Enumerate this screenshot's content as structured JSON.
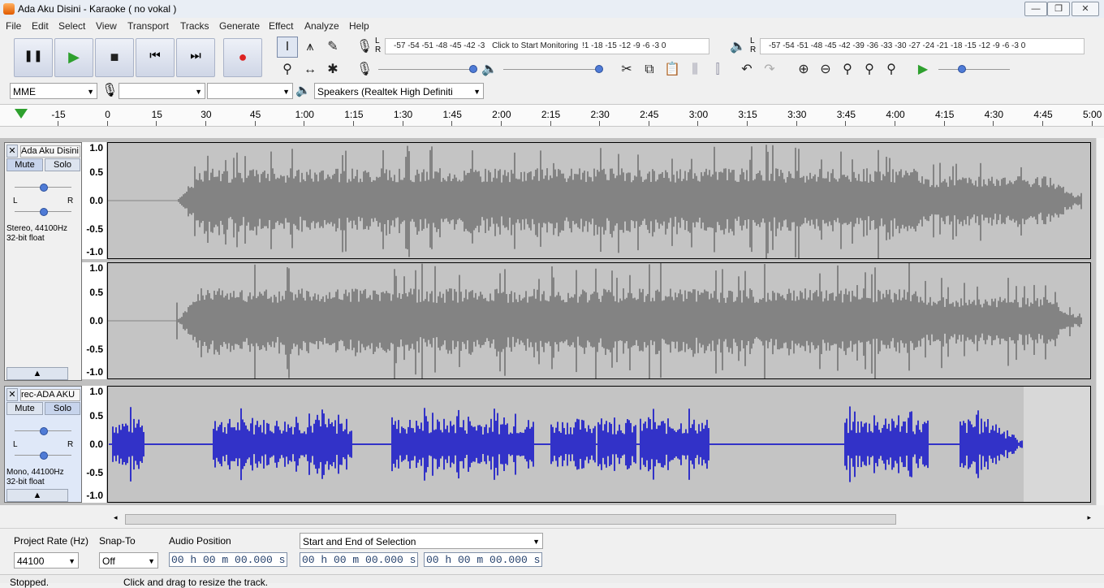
{
  "window": {
    "title": "Ada Aku Disini - Karaoke ( no vokal )"
  },
  "menu": [
    "File",
    "Edit",
    "Select",
    "View",
    "Transport",
    "Tracks",
    "Generate",
    "Effect",
    "Analyze",
    "Help"
  ],
  "transport": {
    "pause": "❚❚",
    "play": "▶",
    "stop": "■",
    "skip_start": "⏮",
    "skip_end": "⏭",
    "record": "●"
  },
  "meters": {
    "record_lr": [
      "L",
      "R"
    ],
    "record_ticks": "-57 -54 -51 -48 -45 -42 -3",
    "monitor_label": "Click to Start Monitoring",
    "record_ticks_right": "!1 -18 -15 -12  -9  -6  -3  0",
    "play_lr": [
      "L",
      "R"
    ],
    "play_ticks": "-57 -54 -51 -48 -45 -42 -39 -36 -33 -30 -27 -24 -21 -18 -15 -12  -9  -6  -3  0"
  },
  "devices": {
    "host": "MME",
    "recording_device": "",
    "channels": "",
    "playback_device": "Speakers (Realtek High Definiti"
  },
  "ruler": {
    "labels": [
      "-15",
      "0",
      "15",
      "30",
      "45",
      "1:00",
      "1:15",
      "1:30",
      "1:45",
      "2:00",
      "2:15",
      "2:30",
      "2:45",
      "3:00",
      "3:15",
      "3:30",
      "3:45",
      "4:00",
      "4:15",
      "4:30",
      "4:45",
      "5:00"
    ]
  },
  "tracks": [
    {
      "name": "Ada Aku Disini",
      "mute": "Mute",
      "solo": "Solo",
      "pan_l": "L",
      "pan_r": "R",
      "info_1": "Stereo, 44100Hz",
      "info_2": "32-bit float",
      "scale": [
        "1.0",
        "0.5",
        "0.0",
        "-0.5",
        "-1.0"
      ],
      "color": "#838383"
    },
    {
      "name": "rec-ADA AKU",
      "mute": "Mute",
      "solo": "Solo",
      "pan_l": "L",
      "pan_r": "R",
      "info_1": "Mono, 44100Hz",
      "info_2": "32-bit float",
      "scale": [
        "1.0",
        "0.5",
        "0.0",
        "-0.5",
        "-1.0"
      ],
      "color": "#3232c8"
    }
  ],
  "selection_toolbar": {
    "project_rate_label": "Project Rate (Hz)",
    "project_rate_value": "44100",
    "snap_to_label": "Snap-To",
    "snap_to_value": "Off",
    "audio_position_label": "Audio Position",
    "audio_position_value": "00 h 00 m 00.000 s",
    "selection_mode": "Start and End of Selection",
    "selection_start": "00 h 00 m 00.000 s",
    "selection_end": "00 h 00 m 00.000 s"
  },
  "status": {
    "left": "Stopped.",
    "right": "Click and drag to resize the track."
  }
}
